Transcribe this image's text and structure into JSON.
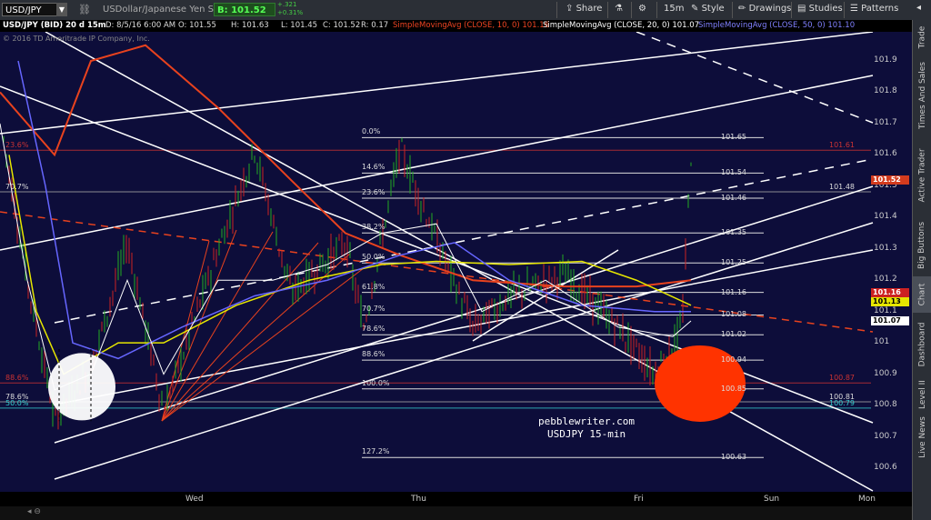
{
  "toolbar": {
    "symbol": "USD/JPY",
    "description": "USDollar/Japanese Yen Spot",
    "bid": "B: 101.52",
    "change_top": "+.321",
    "change_bottom": "+0.31%",
    "share": "Share",
    "timeframe": "15m",
    "style": "Style",
    "drawings": "Drawings",
    "studies": "Studies",
    "patterns": "Patterns"
  },
  "infobar": {
    "title": "USD/JPY (BID) 20 d 15m",
    "date": "D: 8/5/16 6:00 AM",
    "open": "O: 101.55",
    "high": "H: 101.63",
    "low": "L: 101.45",
    "close": "C: 101.52",
    "range": "R: 0.17",
    "sma10": "SimpleMovingAvg (CLOSE, 10, 0)  101.16",
    "sma20": "SimpleMovingAvg (CLOSE, 20, 0)  101.07",
    "sma50": "SimpleMovingAvg (CLOSE, 50, 0)  101.10"
  },
  "copyright": "© 2016 TD Ameritrade IP Company, Inc.",
  "watermark": {
    "line1": "pebblewriter.com",
    "line2": "USDJPY 15-min"
  },
  "sidebar": [
    "Trade",
    "Times And Sales",
    "Active Trader",
    "Big Buttons",
    "Chart",
    "Dashboard",
    "Level II",
    "Live News"
  ],
  "price_labels": [
    "101.9",
    "101.8",
    "101.7",
    "101.6",
    "101.5",
    "101.4",
    "101.3",
    "101.2",
    "101.1",
    "101",
    "100.9",
    "100.8",
    "100.7",
    "100.6"
  ],
  "price_tags": [
    {
      "text": "101.52",
      "bg": "#d33b1e",
      "fg": "#ffffff"
    },
    {
      "text": "101.16",
      "bg": "#cc2222",
      "fg": "#ffffff"
    },
    {
      "text": "101.13",
      "bg": "#e6e600",
      "fg": "#000000"
    },
    {
      "text": "101.07",
      "bg": "#ffffff",
      "fg": "#000000"
    }
  ],
  "fib_left": [
    "0.0%",
    "14.6%",
    "23.6%",
    "38.2%",
    "50.0%",
    "61.8%",
    "70.7%",
    "78.6%",
    "88.6%",
    "100.0%",
    "127.2%"
  ],
  "fib_right": [
    "101.65",
    "101.54",
    "101.46",
    "101.35",
    "101.25",
    "101.16",
    "101.08",
    "101.02",
    "100.94",
    "100.85",
    "100.63"
  ],
  "big_fib_labels": {
    "p23_6": "23.6%",
    "p70_7": "70.7%",
    "p88_6": "88.6%",
    "p78_6": "78.6%",
    "p50_0": "50.0%",
    "r101_61": "101.61",
    "r101_48": "101.48",
    "r100_87": "100.87",
    "r100_81": "100.81",
    "r100_79": "100.79"
  },
  "x_labels": [
    "Wed",
    "Thu",
    "Fri",
    "Sun",
    "Mon"
  ],
  "colors": {
    "background": "#0d0d3a",
    "sma10": "#e8421e",
    "sma20": "#ffffff",
    "sma50": "#6666ff",
    "sma100": "#e6e600",
    "up_bar": "#22aa22",
    "down_bar": "#cc2222",
    "highlight": "#ff3300"
  }
}
